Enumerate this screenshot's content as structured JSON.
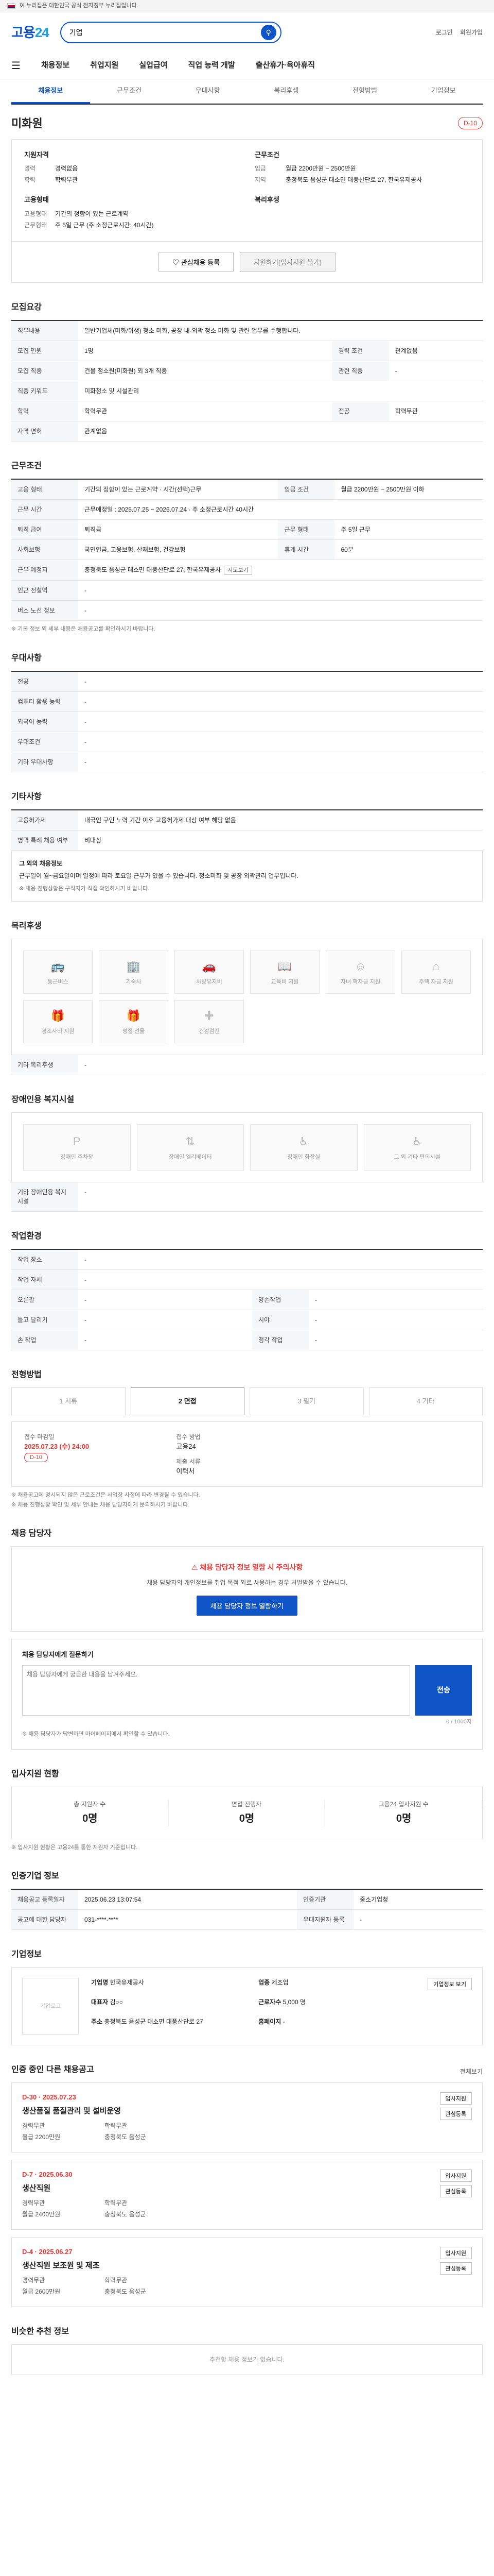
{
  "topbar": {
    "notice": "이 누리집은 대한민국 공식 전자정부 누리집입니다."
  },
  "header": {
    "logo_main": "고용",
    "logo_sub": "24",
    "search_value": "기업",
    "links": [
      "로그인",
      "회원가입"
    ]
  },
  "gnb": [
    "채용정보",
    "취업지원",
    "실업급여",
    "직업 능력 개발",
    "출산휴가·육아휴직"
  ],
  "subnav": [
    "채용정보",
    "근무조건",
    "우대사항",
    "복리후생",
    "전형방법",
    "기업정보"
  ],
  "company": {
    "name": "미화원",
    "badge": "D-10"
  },
  "summary": {
    "company_h": "지원자격",
    "company_kv": [
      {
        "k": "경력",
        "v": "경력없음"
      },
      {
        "k": "학력",
        "v": "학력무관"
      }
    ],
    "cond_h": "근무조건",
    "cond_kv": [
      {
        "k": "임금",
        "v": "월급 2200만원 ~ 2500만원"
      },
      {
        "k": "지역",
        "v": "충청북도 음성군 대소면 대풍산단로 27, 한국유제공사"
      }
    ],
    "type_h": "고용형태",
    "type_kv": [
      {
        "k": "고용형태",
        "v": "기간의 정함이 있는 근로계약"
      },
      {
        "k": "근무형태",
        "v": "주 5일 근무 (주 소정근로시간: 40시간)"
      }
    ],
    "welfare_h": "복리후생",
    "buttons": {
      "fav": "관심채용 등록",
      "apply": "지원하기(입사지원 불가)"
    }
  },
  "recruit": {
    "title": "모집요강",
    "job_label": "직무내용",
    "job_text": "일반기업체(미화/위생) 청소 미화, 공장 내·외곽 청소 미화 및 관련 업무를 수행합니다.",
    "rows": [
      {
        "k": "모집 인원",
        "v": "1명",
        "k2": "경력 조건",
        "v2": "관계없음"
      },
      {
        "k": "모집 직종",
        "v": "건물 청소원(미화원) 외 3개 직종",
        "k2": "관련 직종",
        "v2": "-"
      },
      {
        "k": "직종 키워드",
        "v": "미화청소 및 시설관리",
        "k2": "",
        "v2": ""
      },
      {
        "k": "학력",
        "v": "학력무관",
        "k2": "전공",
        "v2": "학력무관"
      },
      {
        "k": "자격 면허",
        "v": "관계없음",
        "k2": "",
        "v2": ""
      }
    ]
  },
  "conditions": {
    "title": "근무조건",
    "rows": [
      {
        "k": "고용 형태",
        "v": "기간의 정함이 있는 근로계약 · 시간(선택)근무",
        "k2": "임금 조건",
        "v2": "월급 2200만원 ~ 2500만원 이하"
      },
      {
        "k": "근무 시간",
        "v": "근무예정일 : 2025.07.25 ~ 2026.07.24 · 주 소정근로시간 40시간",
        "k2": "",
        "v2": ""
      },
      {
        "k": "퇴직 급여",
        "v": "퇴직금",
        "k2": "근무 형태",
        "v2": "주 5일 근무"
      },
      {
        "k": "사회보험",
        "v": "국민연금, 고용보험, 산재보험, 건강보험",
        "k2": "휴게 시간",
        "v2": "60분"
      },
      {
        "k": "근무 예정지",
        "v": "충청북도 음성군 대소면 대풍산단로 27, 한국유제공사",
        "k2": "",
        "v2": ""
      },
      {
        "k": "인근 전철역",
        "v": "-",
        "k2": "",
        "v2": ""
      },
      {
        "k": "버스 노선 정보",
        "v": "-",
        "k2": "",
        "v2": ""
      }
    ],
    "map_tag": "지도보기",
    "note": "※ 기본 정보 외 세부 내용은 채용공고를 확인하시기 바랍니다."
  },
  "preference": {
    "title": "우대사항",
    "rows": [
      {
        "k": "전공",
        "v": "-"
      },
      {
        "k": "컴퓨터 활용 능력",
        "v": "-"
      },
      {
        "k": "외국어 능력",
        "v": "-"
      },
      {
        "k": "우대조건",
        "v": "-"
      },
      {
        "k": "기타 우대사항",
        "v": "-"
      }
    ]
  },
  "etc": {
    "title": "기타사항",
    "rows": [
      {
        "k": "고용허가제",
        "v": "내국인 구인 노력 기간 이후 고용허가제 대상 여부 해당 없음"
      },
      {
        "k": "병역 특례 채용 여부",
        "v": "비대상"
      }
    ],
    "other_h": "그 외의 채용정보",
    "other_text": "근무일이 월~금요일이며 일정에 따라 토요일 근무가 있을 수 있습니다. 청소미화 및 공장 외곽관리 업무입니다.",
    "other_note": "※ 채용 진행상황은 구직자가 직접 확인하시기 바랍니다."
  },
  "welfare": {
    "title": "복리후생",
    "items": [
      "통근버스",
      "기숙사",
      "차량유지비",
      "교육비 지원",
      "자녀 학자금 지원",
      "주택 자금 지원",
      "경조사비 지원",
      "명절 선물",
      "건강검진"
    ],
    "other_h": "기타 복리후생",
    "other_v": "-"
  },
  "disability": {
    "title": "장애인용 복지시설",
    "items": [
      "장애인 주차장",
      "장애인 엘리베이터",
      "장애인 화장실",
      "그 외 기타 편의시설"
    ],
    "other_h": "기타 장애인용 복지시설",
    "other_v": "-"
  },
  "env": {
    "title": "작업환경",
    "rows": [
      {
        "k": "작업 장소",
        "v": "-",
        "k2": "",
        "v2": ""
      },
      {
        "k": "작업 자세",
        "v": "-",
        "k2": "",
        "v2": ""
      },
      {
        "k": "오른팔",
        "v": "-",
        "k2": "양손작업",
        "v2": "-"
      },
      {
        "k": "들고 달리기",
        "v": "-",
        "k2": "시야",
        "v2": "-"
      },
      {
        "k": "손 작업",
        "v": "-",
        "k2": "청각 작업",
        "v2": "-"
      }
    ]
  },
  "process": {
    "title": "전형방법",
    "steps": [
      "1 서류",
      "2 면접",
      "3 필기",
      "4 기타"
    ],
    "active": 1,
    "deadline_h": "접수 마감일",
    "deadline": "2025.07.23 (수) 24:00",
    "deadline_badge": "D-10",
    "method_h": "접수 방법",
    "method_v": "고용24",
    "docs_h": "제출 서류",
    "docs_v": "이력서",
    "notes": [
      "※ 채용공고에 명시되지 않은 근로조건은 사업장 사정에 따라 변경될 수 있습니다.",
      "※ 채용 진행상황 확인 및 세부 안내는 채용 담당자에게 문의하시기 바랍니다."
    ]
  },
  "contact": {
    "title": "채용 담당자",
    "warn_title": "채용 담당자 정보 열람 시 주의사항",
    "warn_text": "채용 담당자의 개인정보를 취업 목적 외로 사용하는 경우 처벌받을 수 있습니다.",
    "warn_btn": "채용 담당자 정보 열람하기",
    "q_h": "채용 담당자에게 질문하기",
    "q_placeholder": "채용 담당자에게 궁금한 내용을 남겨주세요.",
    "q_count": "0 / 1000자",
    "q_btn": "전송",
    "q_note": "※ 채용 담당자가 답변하면 마이페이지에서 확인할 수 있습니다."
  },
  "status": {
    "title": "입사지원 현황",
    "items": [
      {
        "label": "총 지원자 수",
        "num": "0명"
      },
      {
        "label": "면접 진행자",
        "num": "0명"
      },
      {
        "label": "고용24 입사지원 수",
        "num": "0명"
      }
    ],
    "note": "※ 입사지원 현황은 고용24를 통한 지원자 기준입니다."
  },
  "info": {
    "title": "인증기업 정보",
    "rows": [
      {
        "k": "채용공고 등록일자",
        "v": "2025.06.23 13:07:54",
        "k2": "인증기관",
        "v2": "중소기업청"
      },
      {
        "k": "공고에 대한 담당자",
        "v": "031-****-****",
        "k2": "우대지원자 등록",
        "v2": "-"
      }
    ]
  },
  "company_info": {
    "title": "기업정보",
    "logo_alt": "기업로고",
    "rows": [
      {
        "k": "기업명",
        "v": "한국유제공사"
      },
      {
        "k": "업종",
        "v": "제조업"
      },
      {
        "k": "대표자",
        "v": "김○○"
      },
      {
        "k": "근로자수",
        "v": "5,000 명"
      },
      {
        "k": "주소",
        "v": "충청북도 음성군 대소면 대풍산단로 27"
      },
      {
        "k": "홈페이지",
        "v": "-"
      }
    ],
    "btn_more": "기업정보 보기"
  },
  "other_jobs": {
    "title": "인증 중인 다른 채용공고",
    "more": "전체보기",
    "items": [
      {
        "dday": "D-30 · 2025.07.23",
        "title": "생산품질 품질관리 및 설비운영",
        "m1": "경력무관",
        "m2": "학력무관",
        "m3": "월급 2200만원",
        "m4": "충청북도 음성군"
      },
      {
        "dday": "D-7 · 2025.06.30",
        "title": "생산직원",
        "m1": "경력무관",
        "m2": "학력무관",
        "m3": "월급 2400만원",
        "m4": "충청북도 음성군"
      },
      {
        "dday": "D-4 · 2025.06.27",
        "title": "생산직원 보조원 및 제조",
        "m1": "경력무관",
        "m2": "학력무관",
        "m3": "월급 2600만원",
        "m4": "충청북도 음성군"
      }
    ],
    "apply_btn": "입사지원",
    "fav_btn": "관심등록"
  },
  "nearby": {
    "title": "비슷한 추천 정보",
    "empty": "추천할 채용 정보가 없습니다."
  }
}
